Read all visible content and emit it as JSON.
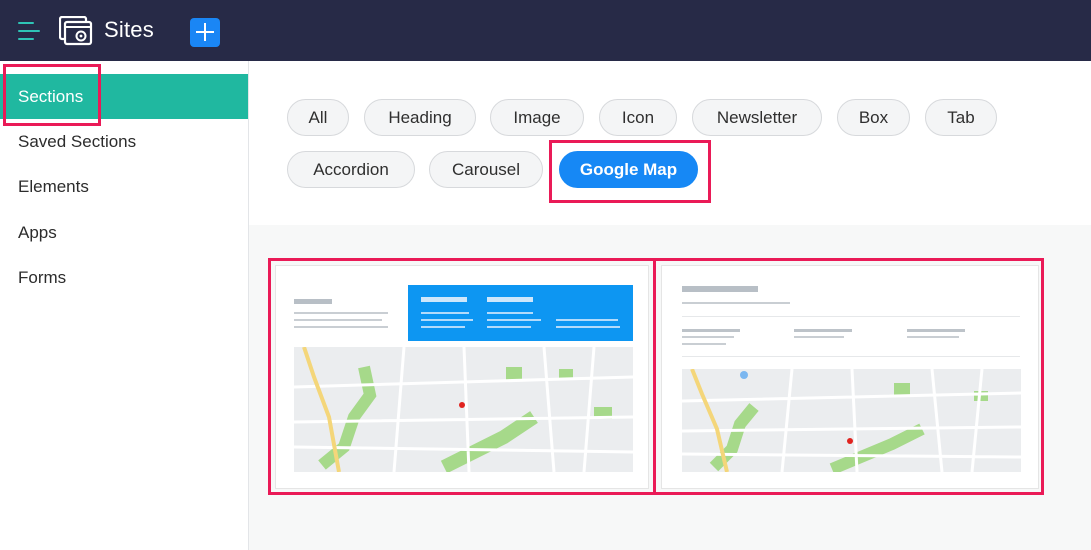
{
  "header": {
    "app_title": "Sites",
    "menu_icon": "hamburger-icon",
    "logo_icon": "sites-logo-icon",
    "add_icon": "plus-icon"
  },
  "sidebar": {
    "items": [
      {
        "label": "Sections",
        "active": true
      },
      {
        "label": "Saved Sections",
        "active": false
      },
      {
        "label": "Elements",
        "active": false
      },
      {
        "label": "Apps",
        "active": false
      },
      {
        "label": "Forms",
        "active": false
      }
    ]
  },
  "filters": {
    "chips": [
      "All",
      "Heading",
      "Image",
      "Icon",
      "Newsletter",
      "Box",
      "Tab",
      "Accordion",
      "Carousel",
      "Google Map"
    ],
    "selected": "Google Map"
  },
  "colors": {
    "topbar": "#272a47",
    "accent_teal": "#20b8a0",
    "accent_blue": "#1688f5",
    "highlight": "#ea1a57"
  }
}
